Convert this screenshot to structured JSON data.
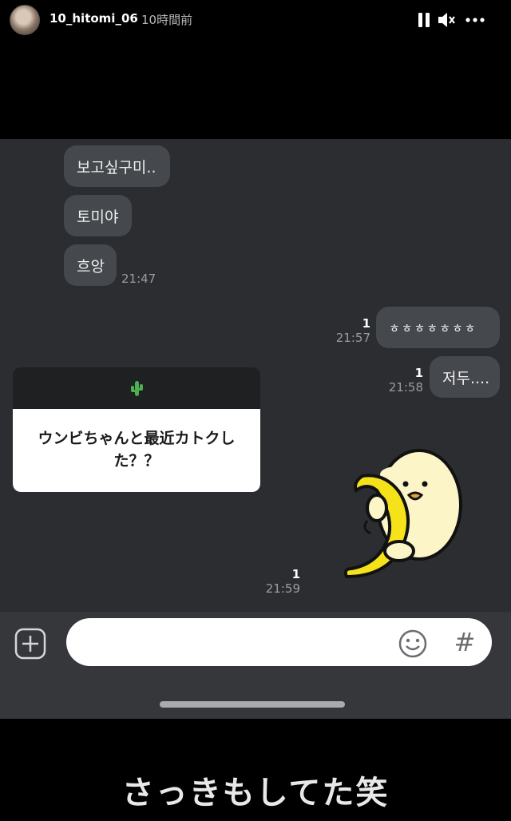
{
  "story": {
    "username": "10_hitomi_06",
    "time_ago": "10時間前",
    "icons": [
      "pause-icon",
      "mute-icon",
      "more-icon"
    ]
  },
  "chat": {
    "incoming": [
      {
        "text": "보고싶구미.."
      },
      {
        "text": "토미야"
      },
      {
        "text": "흐앙",
        "time": "21:47"
      }
    ],
    "outgoing": [
      {
        "text": "ㅎㅎㅎㅎㅎㅎㅎ",
        "read_count": "1",
        "time": "21:57"
      },
      {
        "text": "저두....",
        "read_count": "1",
        "time": "21:58"
      }
    ],
    "share_card": {
      "icon": "cactus-icon",
      "text": "ウンビちゃんと最近カトクした？？"
    },
    "sticker": {
      "icon": "duck-banana-sticker",
      "read_count": "1",
      "time": "21:59"
    }
  },
  "input_bar": {
    "placeholder": "",
    "plus_icon": "plus-icon",
    "emoji_icon": "emoji-icon",
    "hash_label": "#"
  },
  "caption": "さっきもしてた笑",
  "colors": {
    "chat_bg": "#2b2d30",
    "bubble_bg": "#45484d",
    "input_bar_bg": "#35373b"
  }
}
